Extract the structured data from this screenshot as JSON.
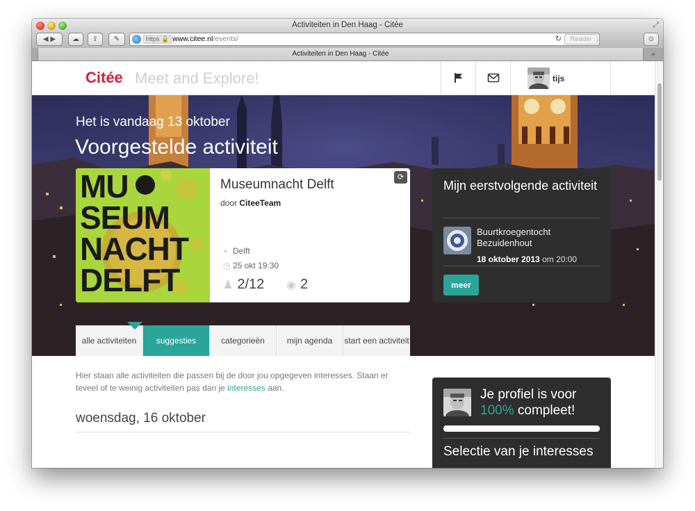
{
  "window": {
    "title": "Activiteiten in Den Haag - Citée",
    "tab_title": "Activiteiten in Den Haag - Citée"
  },
  "browser": {
    "url_scheme": "https",
    "url_host": "www.citee.nl",
    "url_path": "/events/",
    "reader_label": "Reader"
  },
  "header": {
    "logo": "Citée",
    "tagline": "Meet and Explore!",
    "username": "tijs"
  },
  "hero": {
    "date_line": "Het is vandaag 13 oktober",
    "title": "Voorgestelde activiteit"
  },
  "featured": {
    "poster_lines": [
      "MU",
      "SEUM",
      "NACHT",
      "DELFT"
    ],
    "title": "Museumnacht Delft",
    "by_prefix": "door",
    "organizer": "CiteeTeam",
    "location": "Delft",
    "datetime": "25 okt 19:30",
    "attendees": "2/12",
    "views": "2"
  },
  "next_activity": {
    "heading": "Mijn eerstvolgende activiteit",
    "name": "Buurtkroegentocht Bezuidenhout",
    "date_bold": "18 oktober 2013",
    "time_suffix": "om 20:00",
    "button": "meer"
  },
  "tabs": [
    {
      "label": "alle activiteiten",
      "active": false
    },
    {
      "label": "suggesties",
      "active": true
    },
    {
      "label": "categorieën",
      "active": false
    },
    {
      "label": "mijn agenda",
      "active": false
    },
    {
      "label": "start een activiteit",
      "active": false
    }
  ],
  "content": {
    "intro_part1": "Hier staan alle activiteiten die passen bij de door jou opgegeven interesses. Staan er teveel of te weinig activiteiten pas dan je",
    "intro_link": "interesses",
    "intro_part2": "aan.",
    "day_heading": "woensdag, 16 oktober"
  },
  "profile": {
    "line1": "Je profiel is voor",
    "percent": "100%",
    "line2": "compleet!",
    "progress": 1.0,
    "subheading": "Selectie van je interesses"
  },
  "colors": {
    "accent": "#2aa59a",
    "brand": "#d8203a",
    "dark_card": "#2e2e2e"
  },
  "icons": [
    "flag-icon",
    "mail-icon",
    "location-pin-icon",
    "clock-icon",
    "person-icon",
    "eye-icon",
    "refresh-icon"
  ]
}
